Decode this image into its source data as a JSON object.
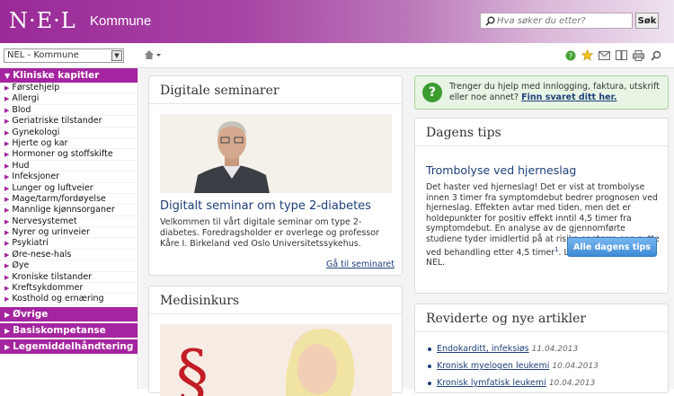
{
  "header": {
    "logo": "N·E·L",
    "subtitle": "Kommune",
    "search_placeholder": "Hva søker du etter?",
    "search_button": "Søk"
  },
  "toolbar": {
    "selector_value": "NEL - Kommune",
    "home_icon": "home-icon",
    "tool_icons": [
      "help-icon",
      "star-icon",
      "mail-icon",
      "book-icon",
      "print-icon",
      "search-icon"
    ]
  },
  "sidebar": {
    "main_section": "Kliniske kapitler",
    "items": [
      "Førstehjelp",
      "Allergi",
      "Blod",
      "Geriatriske tilstander",
      "Gynekologi",
      "Hjerte og kar",
      "Hormoner og stoffskifte",
      "Hud",
      "Infeksjoner",
      "Lunger og luftveier",
      "Mage/tarm/fordøyelse",
      "Mannlige kjønnsorganer",
      "Nervesystemet",
      "Nyrer og urinveier",
      "Psykiatri",
      "Øre-nese-hals",
      "Øye",
      "Kroniske tilstander",
      "Kreftsykdommer",
      "Kosthold og ernæring"
    ],
    "other_sections": [
      "Øvrige",
      "Basiskompetanse",
      "Legemiddelhåndtering"
    ]
  },
  "seminar": {
    "heading": "Digitale seminarer",
    "title": "Digitalt seminar om type 2-diabetes",
    "description": "Velkommen til vårt digitale seminar om type 2-diabetes. Foredragsholder er overlege og professor Kåre I. Birkeland ved Oslo Universitetssykehus.",
    "link": "Gå til seminaret"
  },
  "kurs": {
    "heading": "Medisinkurs"
  },
  "help": {
    "text": "Trenger du hjelp med innlogging, faktura, utskrift eller noe annet?",
    "link": "Finn svaret ditt her."
  },
  "tips": {
    "heading": "Dagens tips",
    "title": "Trombolyse ved hjerneslag",
    "body": "Det haster ved hjerneslag! Det er vist at trombolyse innen 3 timer fra symptomdebut bedrer prognosen ved hjerneslag. Effekten avtar med tiden, men det er holdepunkter for positiv effekt inntil 4,5 timer fra symptomdebut. En analyse av de gjennomførte studiene tyder imidlertid på at risiko er større enn nytte ved behandling etter 4,5 timer",
    "superscript": "1",
    "read_more_prefix": ". Les om",
    "read_more_link": "hjerneslag",
    "read_more_suffix": "i NEL.",
    "button": "Alle dagens tips"
  },
  "articles": {
    "heading": "Reviderte og nye artikler",
    "items": [
      {
        "title": "Endokarditt, infeksiøs",
        "date": "11.04.2013"
      },
      {
        "title": "Kronisk myelogen leukemi",
        "date": "10.04.2013"
      },
      {
        "title": "Kronisk lymfatisk leukemi",
        "date": "10.04.2013"
      }
    ]
  }
}
